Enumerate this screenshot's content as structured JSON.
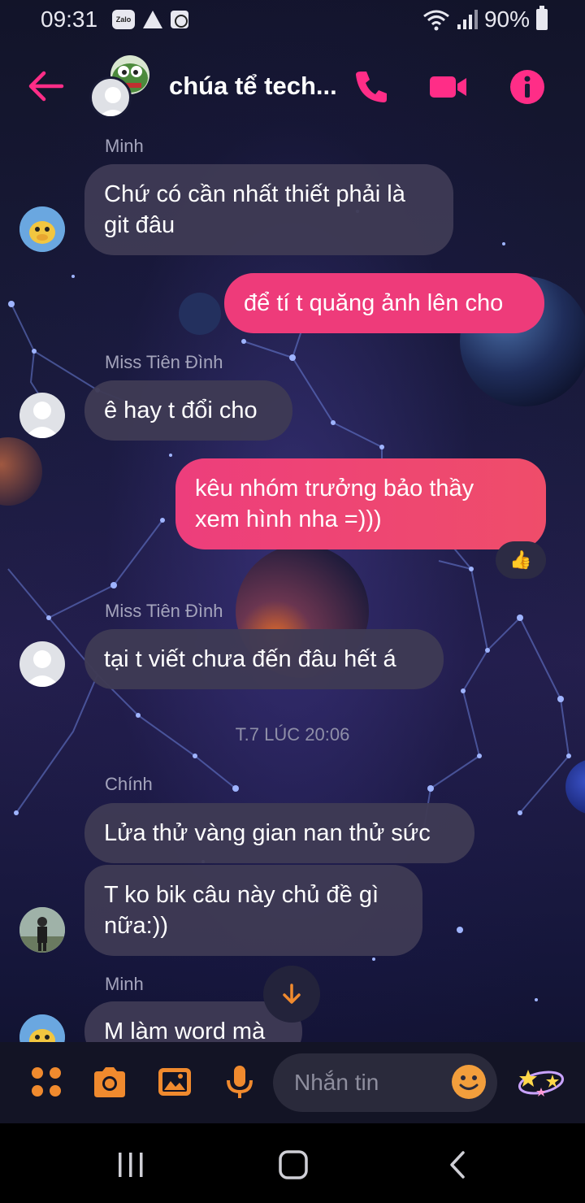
{
  "status_bar": {
    "time": "09:31",
    "zalo_label": "Zalo",
    "battery": "90%"
  },
  "header": {
    "title": "chúa tể tech..."
  },
  "messages": [
    {
      "sender": "Minh",
      "lines": [
        "Chứ có cần nhất thiết phải là",
        "git đâu"
      ]
    },
    {
      "me": true,
      "lines": [
        "để tí t quăng ảnh lên cho"
      ]
    },
    {
      "sender": "Miss Tiên Đình",
      "lines": [
        "ê hay t đổi cho"
      ]
    },
    {
      "me": true,
      "lines": [
        "kêu nhóm trưởng bảo thầy",
        "xem hình nha =)))"
      ],
      "reaction": "👍"
    },
    {
      "sender": "Miss Tiên Đình",
      "lines": [
        "tại t viết chưa đến đâu hết á"
      ]
    },
    {
      "timestamp": "T.7 LÚC 20:06"
    },
    {
      "sender": "Chính",
      "lines": [
        "Lửa thử vàng gian nan thử sức"
      ]
    },
    {
      "lines": [
        "T ko bik câu này chủ đề gì",
        "nữa:))"
      ]
    },
    {
      "sender": "Minh",
      "lines": [
        "M làm word mà"
      ]
    }
  ],
  "composer": {
    "placeholder": "Nhắn tin"
  },
  "colors": {
    "accent": "#ff2d87",
    "me_bubble": "#ee3b7a",
    "composer_icons": "#f08a2e"
  },
  "icons": [
    "back-arrow-icon",
    "phone-icon",
    "video-camera-icon",
    "info-icon",
    "apps-grid-icon",
    "camera-icon",
    "image-icon",
    "microphone-icon",
    "emoji-icon",
    "sticker-icon",
    "scroll-down-arrow-icon"
  ]
}
